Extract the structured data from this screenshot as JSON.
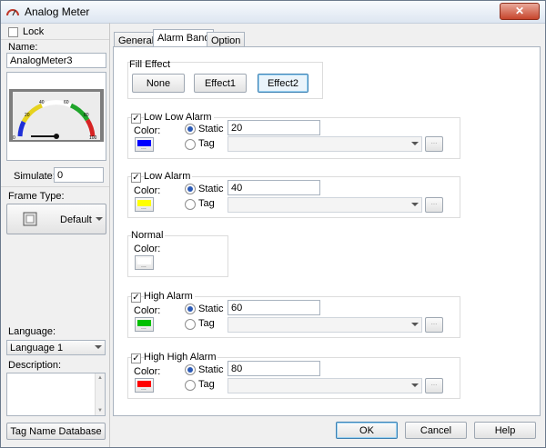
{
  "window": {
    "title": "Analog Meter",
    "close_label": "✕"
  },
  "left": {
    "lock_label": "Lock",
    "name_label": "Name:",
    "name_value": "AnalogMeter3",
    "meter": {
      "ticks": [
        "0",
        "20",
        "40",
        "60",
        "80",
        "100"
      ]
    },
    "simulate_label": "Simulate:",
    "simulate_value": "0",
    "frame_type_label": "Frame Type:",
    "frame_type_value": "Default",
    "language_label": "Language:",
    "language_value": "Language 1",
    "description_label": "Description:",
    "tag_db_button": "Tag Name Database"
  },
  "tabs": [
    "General",
    "Alarm Band",
    "Option"
  ],
  "alarm_band": {
    "fill_effect_label": "Fill Effect",
    "fill_buttons": [
      "None",
      "Effect1",
      "Effect2"
    ],
    "color_label": "Color:",
    "static_label": "Static",
    "tag_label": "Tag",
    "normal_label": "Normal",
    "swatch_dots": "...",
    "alarms": [
      {
        "name": "Low Low Alarm",
        "value": "20",
        "color": "#0000ff"
      },
      {
        "name": "Low Alarm",
        "value": "40",
        "color": "#ffff00"
      },
      {
        "name": "High Alarm",
        "value": "60",
        "color": "#00c000"
      },
      {
        "name": "High High Alarm",
        "value": "80",
        "color": "#ff0000"
      }
    ],
    "normal_color": "#ffffff"
  },
  "footer": {
    "ok": "OK",
    "cancel": "Cancel",
    "help": "Help"
  }
}
